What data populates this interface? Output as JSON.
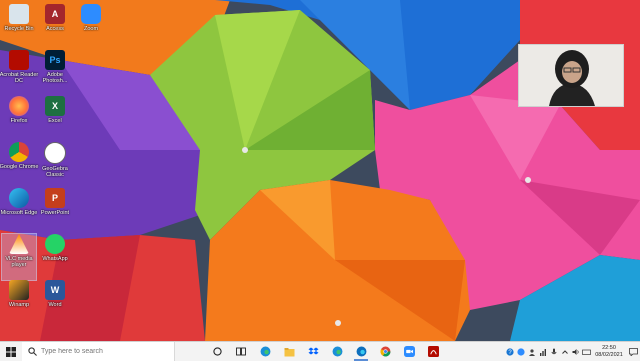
{
  "desktop": {
    "icons": [
      {
        "label": "Recycle Bin",
        "icon": "recycle-bin-icon"
      },
      {
        "label": "Access",
        "icon": "access-icon",
        "glyph": "A"
      },
      {
        "label": "Zoom",
        "icon": "zoom-icon"
      },
      {
        "label": "Acrobat Reader DC",
        "icon": "acrobat-icon"
      },
      {
        "label": "Adobe Photosh...",
        "icon": "photoshop-icon",
        "glyph": "Ps"
      },
      {
        "label": "Firefox",
        "icon": "firefox-icon"
      },
      {
        "label": "Excel",
        "icon": "excel-icon",
        "glyph": "X"
      },
      {
        "label": "Google Chrome",
        "icon": "chrome-icon"
      },
      {
        "label": "GeoGebra Classic",
        "icon": "geogebra-icon"
      },
      {
        "label": "Microsoft Edge",
        "icon": "edge-icon"
      },
      {
        "label": "PowerPoint",
        "icon": "powerpoint-icon",
        "glyph": "P"
      },
      {
        "label": "VLC media player",
        "icon": "vlc-icon"
      },
      {
        "label": "WhatsApp",
        "icon": "whatsapp-icon"
      },
      {
        "label": "Winamp",
        "icon": "winamp-icon"
      },
      {
        "label": "Word",
        "icon": "word-icon",
        "glyph": "W"
      }
    ]
  },
  "webcam": {
    "description_icon": "person-video-icon"
  },
  "taskbar": {
    "search_placeholder": "Type here to search",
    "apps": [
      {
        "name": "cortana-icon"
      },
      {
        "name": "task-view-icon"
      },
      {
        "name": "edge-icon"
      },
      {
        "name": "file-explorer-icon"
      },
      {
        "name": "dropbox-icon"
      },
      {
        "name": "edge-icon"
      },
      {
        "name": "edge-active-icon"
      },
      {
        "name": "chrome-icon"
      },
      {
        "name": "zoom-icon"
      },
      {
        "name": "acrobat-icon"
      }
    ],
    "clock_time": "22:50",
    "clock_date": "08/02/2021"
  },
  "colors": {
    "taskbar": "#f3f3f3",
    "accent": "#2d8cff"
  }
}
